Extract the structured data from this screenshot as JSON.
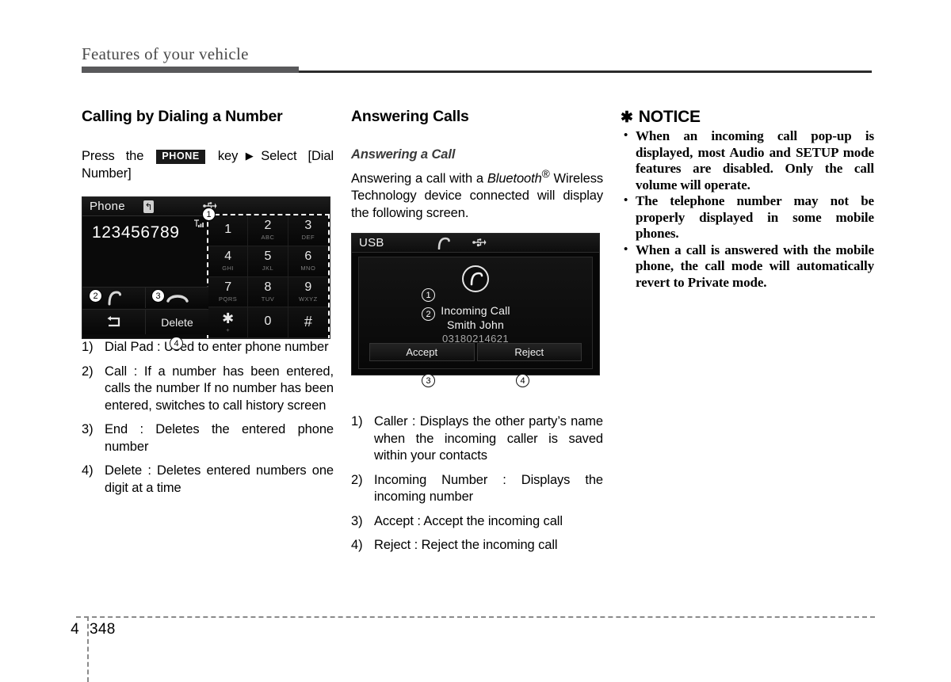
{
  "page": {
    "running_header": "Features of your vehicle",
    "chapter_number": "4",
    "page_number": "348"
  },
  "left_column": {
    "section_title": "Calling by Dialing a Number",
    "instruction": {
      "before_key": "Press the",
      "key_label": "PHONE",
      "after_key": "key",
      "arrow": "▶",
      "tail": "Select [Dial Number]"
    },
    "figure": {
      "name": "phone-dial-pad-screen",
      "header_label": "Phone",
      "bluetooth_icon": "bluetooth-icon",
      "usb_icon": "usb-icon",
      "signal_icon": "signal-strength-icon",
      "entered_number": "123456789",
      "keypad": [
        {
          "digit": "1",
          "letters": ""
        },
        {
          "digit": "2",
          "letters": "ABC"
        },
        {
          "digit": "3",
          "letters": "DEF"
        },
        {
          "digit": "4",
          "letters": "GHI"
        },
        {
          "digit": "5",
          "letters": "JKL"
        },
        {
          "digit": "6",
          "letters": "MNO"
        },
        {
          "digit": "7",
          "letters": "PQRS"
        },
        {
          "digit": "8",
          "letters": "TUV"
        },
        {
          "digit": "9",
          "letters": "WXYZ"
        },
        {
          "digit": "✱",
          "letters": "+"
        },
        {
          "digit": "0",
          "letters": ""
        },
        {
          "digit": "#",
          "letters": ""
        }
      ],
      "call_button_icon": "call-handset-icon",
      "end_button_icon": "end-call-icon",
      "back_button_icon": "back-arrow-icon",
      "delete_label": "Delete",
      "markers": {
        "m1": "1",
        "m2": "2",
        "m3": "3",
        "m4": "4"
      }
    },
    "items": [
      {
        "num": "1)",
        "text": "Dial Pad : Used to enter phone number"
      },
      {
        "num": "2)",
        "text": "Call : If a number has been entered, calls the number If no number has been entered, switches to call history screen"
      },
      {
        "num": "3)",
        "text": "End : Deletes the entered phone number"
      },
      {
        "num": "4)",
        "text": "Delete : Deletes entered numbers one digit at a time"
      }
    ]
  },
  "middle_column": {
    "section_title": "Answering Calls",
    "sub_title": "Answering a Call",
    "paragraph_pre": "Answering a call with a ",
    "paragraph_em": "Bluetooth",
    "paragraph_sup": "®",
    "paragraph_post": " Wireless Technology device connected will display the following screen.",
    "figure": {
      "name": "incoming-call-screen",
      "header_label": "USB",
      "call_icon": "call-handset-icon",
      "usb_icon": "usb-icon",
      "phone_badge_icon": "phone-ringing-icon",
      "title": "Incoming Call",
      "caller_name": "Smith John",
      "caller_number": "03180214621",
      "accept_label": "Accept",
      "reject_label": "Reject",
      "markers": {
        "m1": "1",
        "m2": "2",
        "m3": "3",
        "m4": "4"
      }
    },
    "items": [
      {
        "num": "1)",
        "text": "Caller : Displays the other party’s name when the incoming caller is saved within your contacts"
      },
      {
        "num": "2)",
        "text": "Incoming Number : Displays the incoming number"
      },
      {
        "num": "3)",
        "text": "Accept : Accept the incoming call"
      },
      {
        "num": "4)",
        "text": "Reject : Reject the incoming call"
      }
    ]
  },
  "right_column": {
    "notice_icon": "✱",
    "notice_title": "NOTICE",
    "bullet": "•",
    "notices": [
      "When an incoming call pop-up is displayed, most Audio and SETUP mode features are disabled. Only the call volume will operate.",
      "The telephone number may not be properly displayed in some mobile phones.",
      "When a call is answered with the mobile phone, the call mode will automatically revert to Private mode."
    ]
  }
}
